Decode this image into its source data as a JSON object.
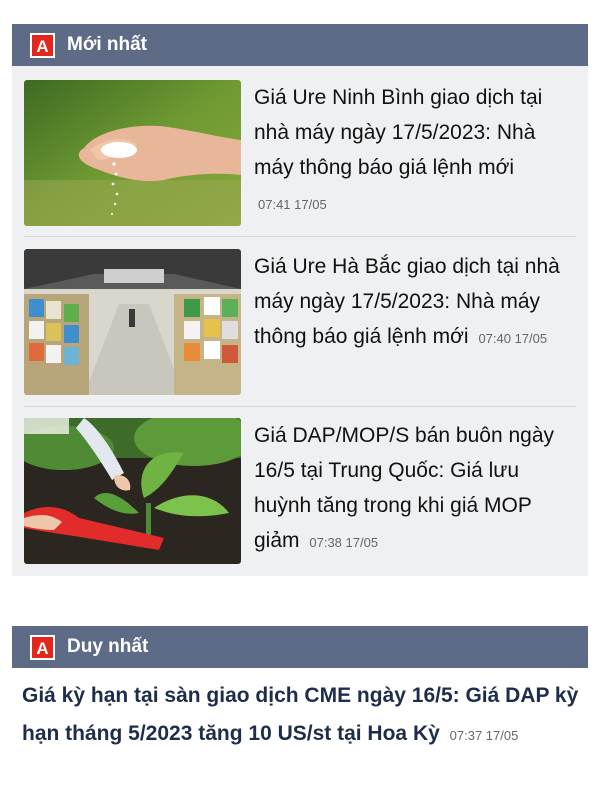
{
  "sections": {
    "latest": {
      "title": "Mới nhất",
      "logo_letter": "A",
      "articles": [
        {
          "title": "Giá Ure Ninh Bình giao dịch tại nhà máy ngày 17/5/2023: Nhà máy thông báo giá lệnh mới",
          "time": "07:41 17/05",
          "image": "hand-pouring-fertilizer"
        },
        {
          "title": "Giá Ure Hà Bắc giao dịch tại nhà máy ngày 17/5/2023: Nhà máy thông báo giá lệnh mới",
          "time": "07:40 17/05",
          "image": "fertilizer-warehouse"
        },
        {
          "title": "Giá DAP/MOP/S bán buôn ngày 16/5 tại Trung Quốc: Giá lưu huỳnh tăng trong khi giá MOP giảm",
          "time": "07:38 17/05",
          "image": "planting-seedling"
        }
      ]
    },
    "unique": {
      "title": "Duy nhất",
      "logo_letter": "A",
      "article": {
        "title": "Giá kỳ hạn tại sàn giao dịch CME ngày 16/5: Giá DAP kỳ hạn tháng 5/2023 tăng 10 US/st tại Hoa Kỳ",
        "time": "07:37 17/05"
      }
    }
  },
  "colors": {
    "header_bg": "#5d6b87",
    "brand_red": "#e5261d",
    "section_bg": "#eff0f2"
  }
}
